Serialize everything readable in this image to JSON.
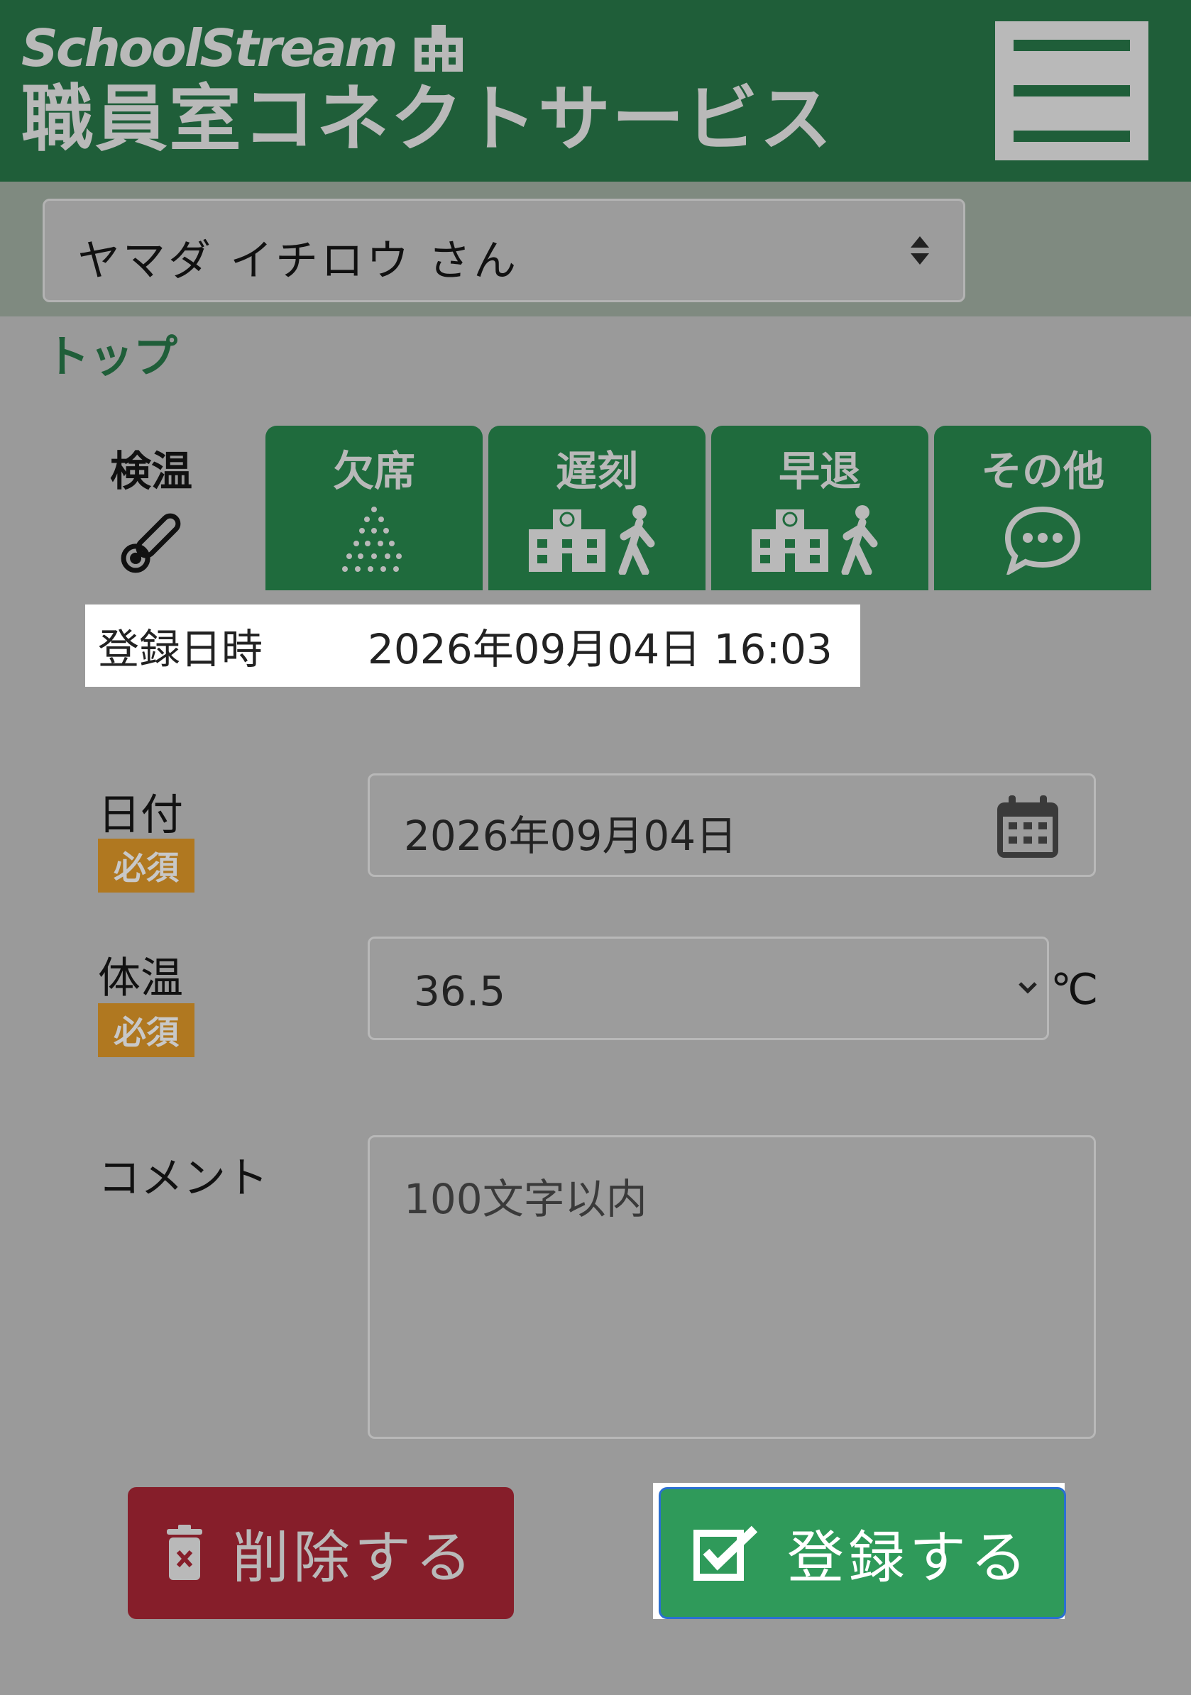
{
  "header": {
    "brand_top": "SchoolStream",
    "brand_bottom": "職員室コネクトサービス",
    "menu_icon": "hamburger-menu-icon"
  },
  "student": {
    "selected": "ヤマダ イチロウ さん"
  },
  "breadcrumb": "トップ",
  "tabs": [
    {
      "label": "検温",
      "icon": "thermometer-icon",
      "active": true
    },
    {
      "label": "欠席",
      "icon": "absence-dots-icon",
      "active": false
    },
    {
      "label": "遅刻",
      "icon": "school-walker-icon",
      "active": false
    },
    {
      "label": "早退",
      "icon": "school-walker-icon",
      "active": false
    },
    {
      "label": "その他",
      "icon": "speech-bubble-icon",
      "active": false
    }
  ],
  "registered": {
    "label": "登録日時",
    "value": "2026年09月04日 16:03"
  },
  "form": {
    "date_label": "日付",
    "date_value": "2026年09月04日",
    "temp_label": "体温",
    "temp_value": "36.5",
    "temp_unit": "℃",
    "required_badge": "必須",
    "comment_label": "コメント",
    "comment_placeholder": "100文字以内"
  },
  "buttons": {
    "delete": "削除する",
    "register": "登録する"
  },
  "colors": {
    "brand_green": "#1f5e39",
    "tab_green": "#1f6b3d",
    "required_orange": "#b07820",
    "delete_red": "#861e2a",
    "register_green": "#2f9a5a"
  }
}
